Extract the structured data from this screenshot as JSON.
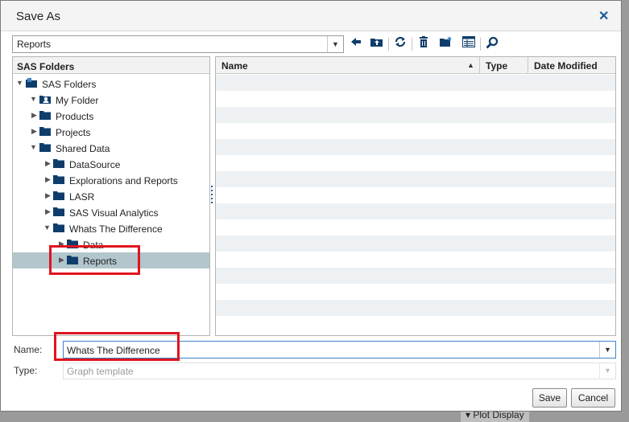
{
  "dialog": {
    "title": "Save As"
  },
  "location": {
    "value": "Reports"
  },
  "tree": {
    "header": "SAS Folders",
    "items": [
      {
        "label": "SAS Folders"
      },
      {
        "label": "My Folder"
      },
      {
        "label": "Products"
      },
      {
        "label": "Projects"
      },
      {
        "label": "Shared Data"
      },
      {
        "label": "DataSource"
      },
      {
        "label": "Explorations and Reports"
      },
      {
        "label": "LASR"
      },
      {
        "label": "SAS Visual Analytics"
      },
      {
        "label": "Whats The Difference"
      },
      {
        "label": "Data"
      },
      {
        "label": "Reports"
      }
    ]
  },
  "list": {
    "columns": [
      "Name",
      "Type",
      "Date Modified"
    ]
  },
  "form": {
    "name_label": "Name:",
    "name_value": "Whats The Difference",
    "type_label": "Type:",
    "type_placeholder": "Graph template"
  },
  "buttons": {
    "save": "Save",
    "cancel": "Cancel"
  },
  "backdrop": {
    "plot_display": "Plot Display"
  },
  "colors": {
    "accent": "#0f3d6b",
    "selection": "#b2c6cc",
    "highlight": "#e0141e"
  }
}
